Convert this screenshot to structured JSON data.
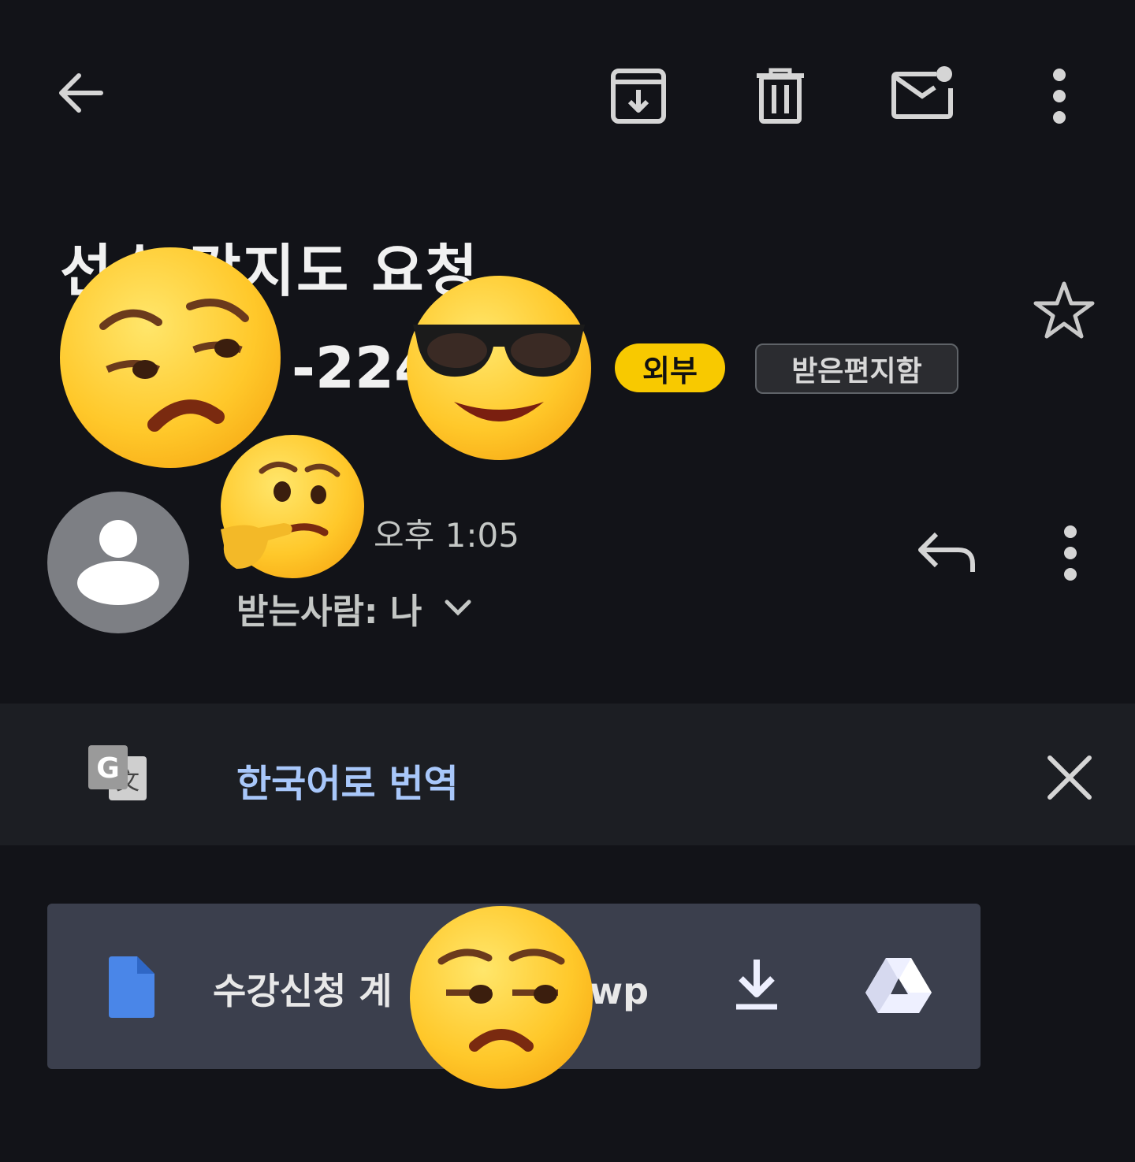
{
  "toolbar": {
    "back_icon": "arrow-back-icon",
    "archive_icon": "archive-icon",
    "delete_icon": "trash-icon",
    "mark_unread_icon": "mail-unread-icon",
    "more_icon": "more-vert-icon"
  },
  "email": {
    "subject": "선수 강지도 요청",
    "sender_fragment": "-224",
    "labels": {
      "external": "외부",
      "inbox": "받은편지함"
    },
    "star_icon": "star-outline-icon",
    "time": "오후 1:05",
    "recipient": "받는사람: 나",
    "recipient_chevron_icon": "chevron-down-icon",
    "reply_icon": "reply-icon",
    "more_icon": "more-vert-icon"
  },
  "translate": {
    "icon": "google-translate-icon",
    "link": "한국어로 번역",
    "close_icon": "close-icon"
  },
  "attachment": {
    "file_icon": "document-icon",
    "file_name_start": "수강신청 계",
    "file_name_end": "wp",
    "download_icon": "download-icon",
    "drive_icon": "google-drive-icon"
  },
  "overlays": {
    "emojis": [
      "unamused-face-emoji",
      "sunglasses-face-emoji",
      "thinking-face-emoji",
      "unamused-face-emoji"
    ]
  },
  "colors": {
    "background": "#121318",
    "external_label": "#f8c900",
    "translate_link": "#a8c7fa",
    "attachment_bg": "#3b3f4d",
    "file_icon": "#4a86e8"
  }
}
